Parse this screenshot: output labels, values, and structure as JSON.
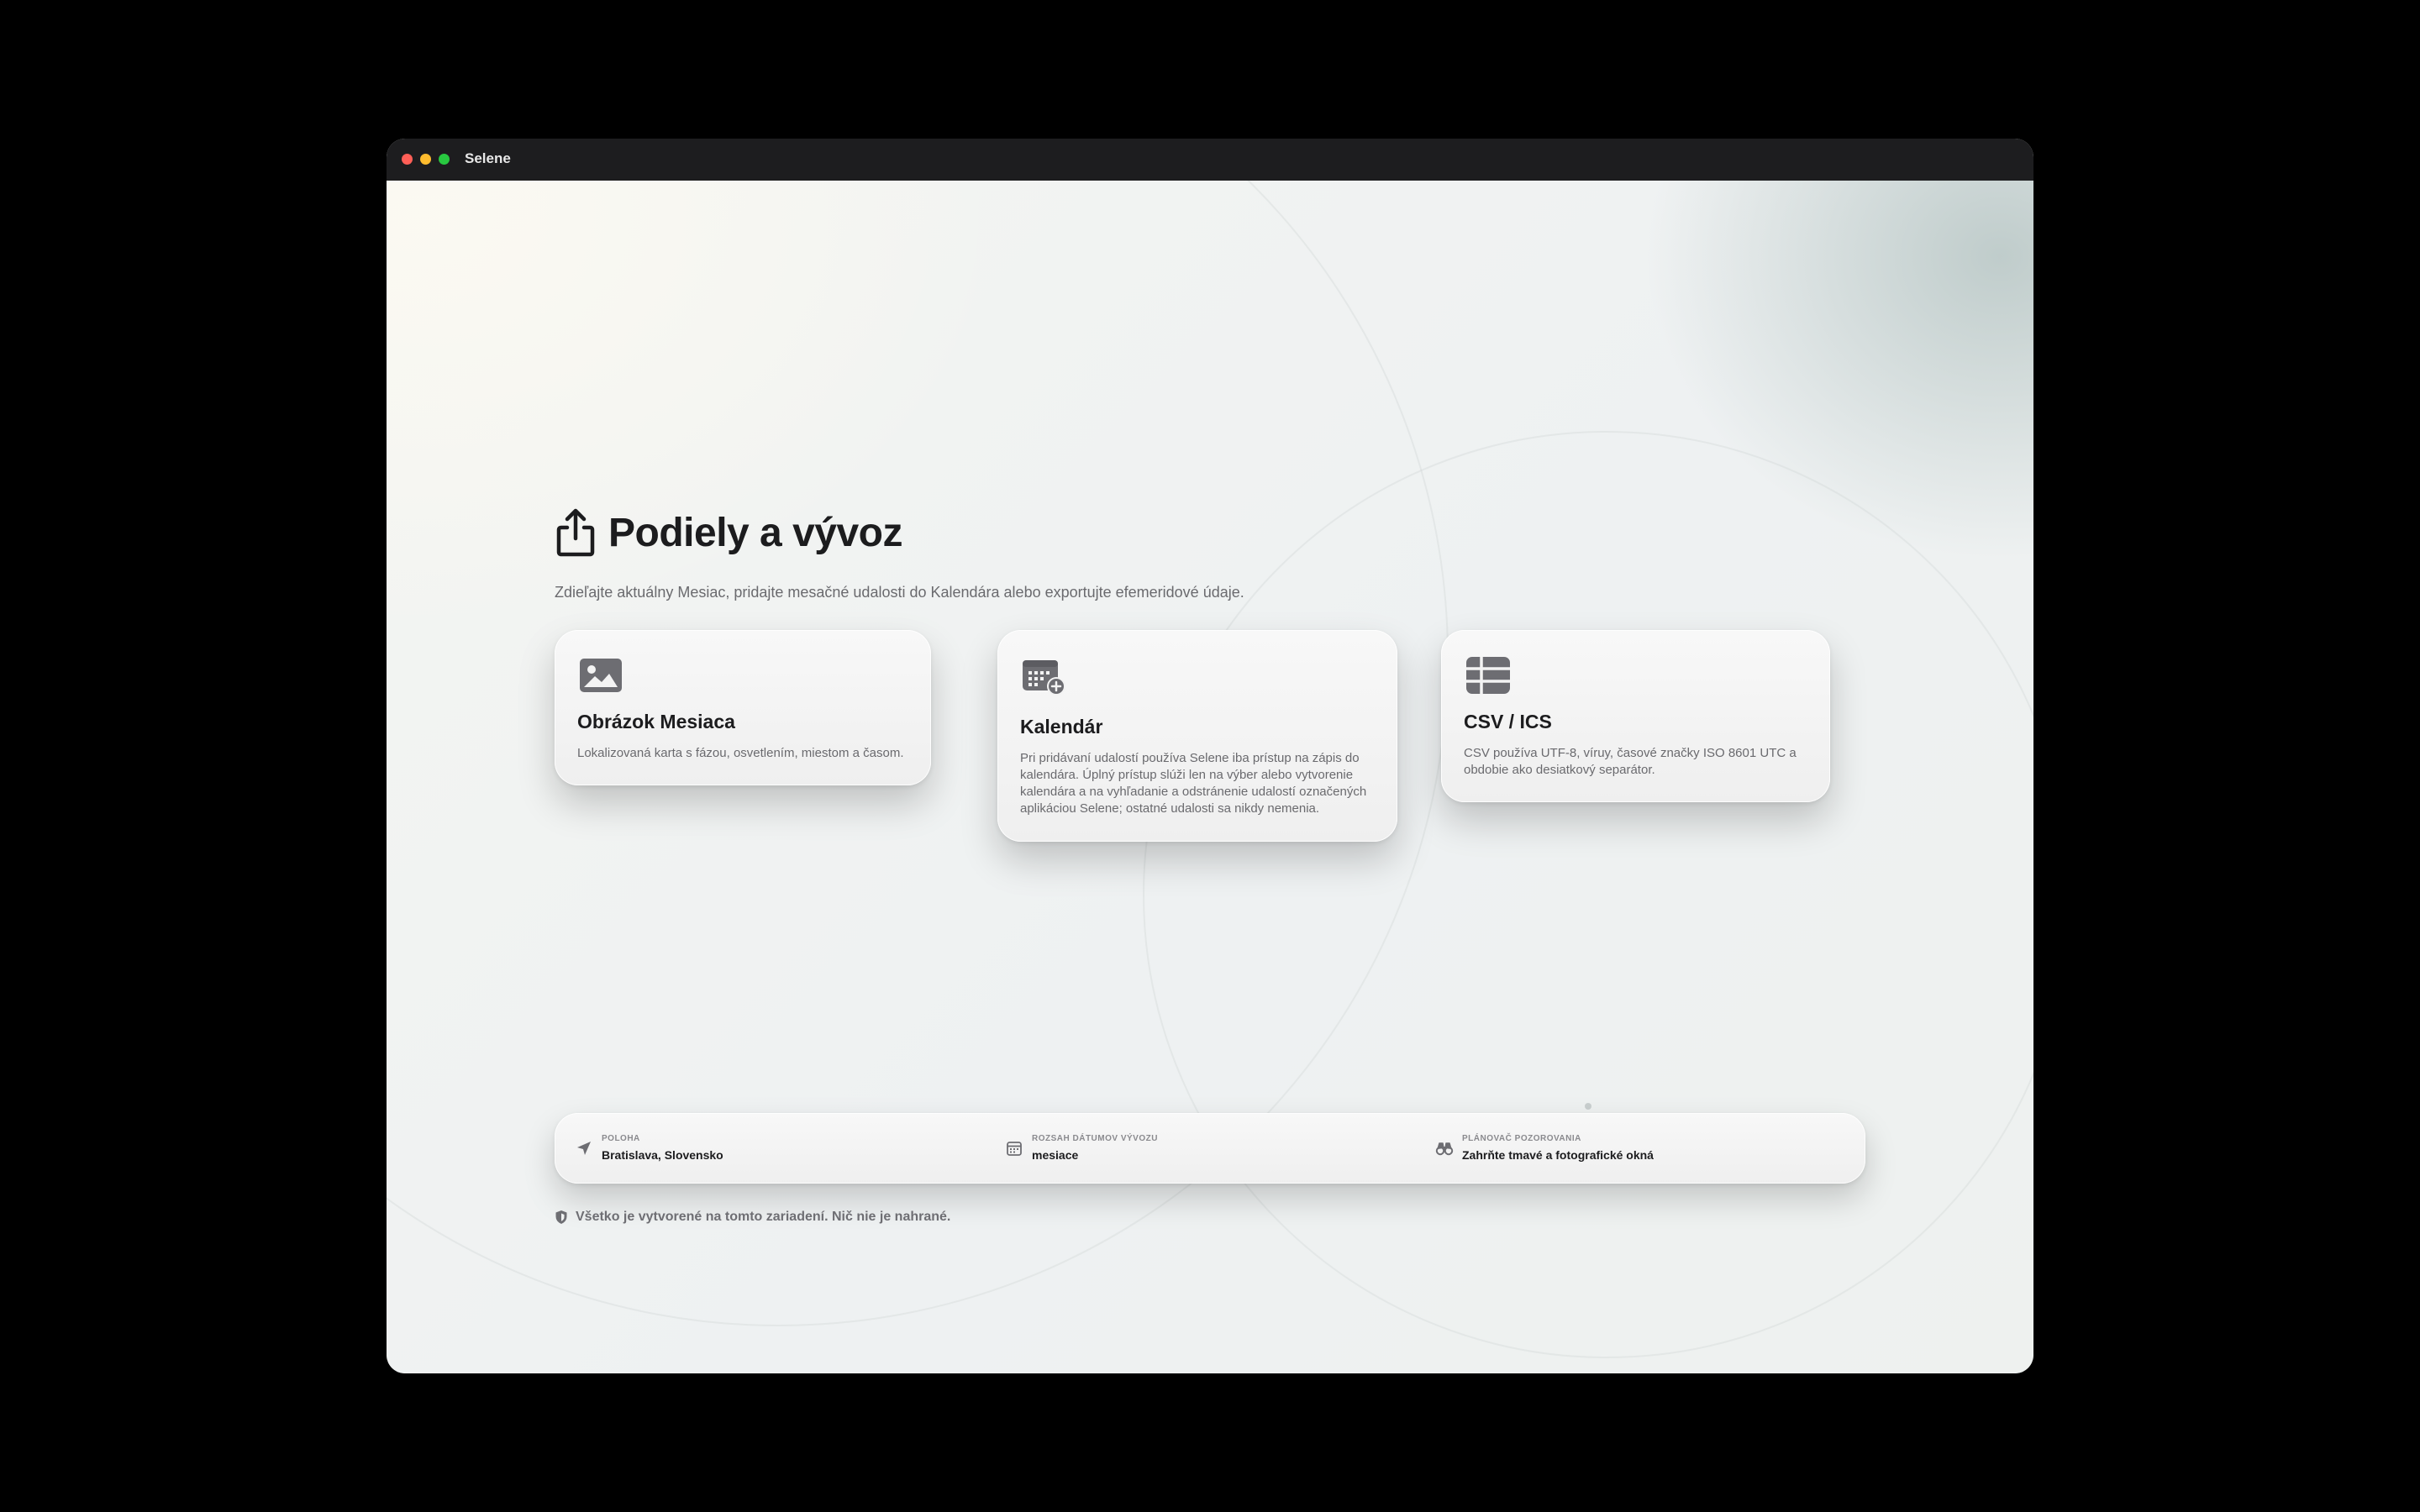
{
  "window": {
    "title": "Selene",
    "traffic_lights": {
      "close": "#ff5f57",
      "minimize": "#febc2e",
      "maximize": "#28c840"
    }
  },
  "page": {
    "heading": "Podiely a vývoz",
    "heading_icon": "share-icon",
    "subtitle": "Zdieľajte aktuálny Mesiac, pridajte mesačné udalosti do Kalendára alebo exportujte efemeridové údaje."
  },
  "cards": [
    {
      "icon": "photo-icon",
      "title": "Obrázok Mesiaca",
      "description": "Lokalizovaná karta s fázou, osvetlením, miestom a časom."
    },
    {
      "icon": "calendar-add-icon",
      "title": "Kalendár",
      "description": "Pri pridávaní udalostí používa Selene iba prístup na zápis do kalendára. Úplný prístup slúži len na výber alebo vytvorenie kalendára a na vyhľadanie a odstránenie udalostí označených aplikáciou Selene; ostatné udalosti sa nikdy nemenia."
    },
    {
      "icon": "table-icon",
      "title": "CSV / ICS",
      "description": "CSV používa UTF-8, víruy, časové značky ISO 8601 UTC a obdobie ako desiatkový separátor."
    }
  ],
  "settings_bar": {
    "location": {
      "icon": "location-arrow-icon",
      "label": "POLOHA",
      "value": "Bratislava, Slovensko"
    },
    "date_range": {
      "icon": "calendar-icon",
      "label": "ROZSAH DÁTUMOV VÝVOZU",
      "value": "mesiace"
    },
    "planner": {
      "icon": "binoculars-icon",
      "label": "PLÁNOVAČ POZOROVANIA",
      "value": "Zahrňte tmavé a fotografické okná"
    }
  },
  "footer": {
    "icon": "shield-icon",
    "note": "Všetko je vytvorené na tomto zariadení. Nič nie je nahrané."
  },
  "colors": {
    "title_text": "#1c1c1e",
    "secondary_text": "#6a6a6e",
    "icon_gray": "#6d6d72",
    "titlebar": "#1d1d1f"
  }
}
